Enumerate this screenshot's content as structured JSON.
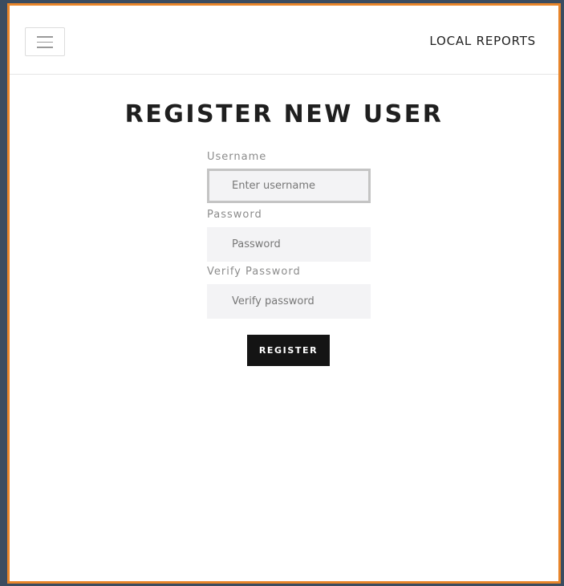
{
  "navbar": {
    "brand": "LOCAL REPORTS",
    "menu_icon": "hamburger-menu-icon"
  },
  "page": {
    "title": "REGISTER NEW USER"
  },
  "form": {
    "username": {
      "label": "Username",
      "placeholder": "Enter username",
      "value": ""
    },
    "password": {
      "label": "Password",
      "placeholder": "Password",
      "value": ""
    },
    "verify_password": {
      "label": "Verify Password",
      "placeholder": "Verify password",
      "value": ""
    },
    "submit_label": "REGISTER"
  },
  "colors": {
    "frame_border": "#e8852a",
    "background": "#3b4c60",
    "button": "#141414",
    "input_bg": "#f3f3f5"
  }
}
